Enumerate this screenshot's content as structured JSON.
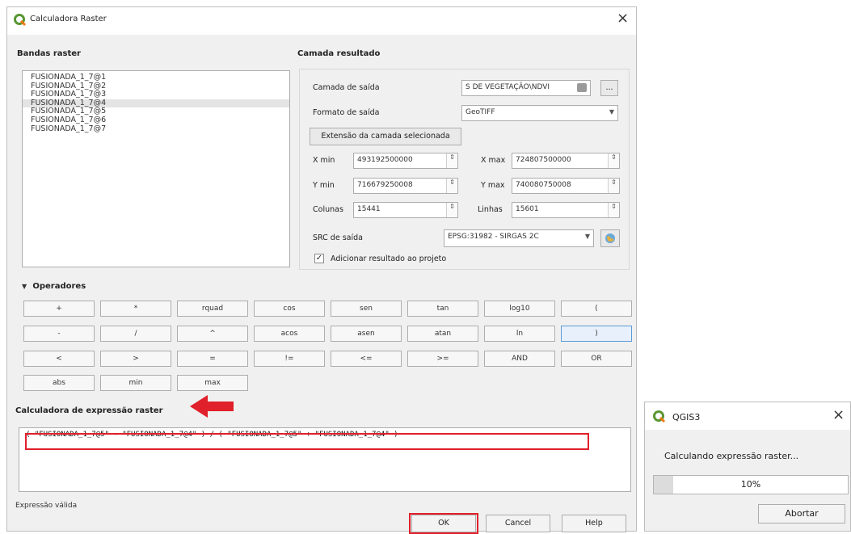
{
  "dialog": {
    "title": "Calculadora Raster",
    "close_glyph": "×"
  },
  "bands": {
    "title": "Bandas raster",
    "items": [
      "FUSIONADA_1_7@1",
      "FUSIONADA_1_7@2",
      "FUSIONADA_1_7@3",
      "FUSIONADA_1_7@4",
      "FUSIONADA_1_7@5",
      "FUSIONADA_1_7@6",
      "FUSIONADA_1_7@7"
    ],
    "selected_index": 3
  },
  "result": {
    "title": "Camada resultado",
    "output_layer_label": "Camada de saída",
    "output_layer_value": "S DE VEGETAÇÃO\\NDVI",
    "browse_label": "...",
    "format_label": "Formato de saída",
    "format_value": "GeoTIFF",
    "extent_button": "Extensão da camada selecionada",
    "xmin_label": "X min",
    "xmin_value": "493192500000",
    "xmax_label": "X max",
    "xmax_value": "724807500000",
    "ymin_label": "Y min",
    "ymin_value": "716679250008",
    "ymax_label": "Y max",
    "ymax_value": "740080750008",
    "columns_label": "Colunas",
    "columns_value": "15441",
    "rows_label": "Linhas",
    "rows_value": "15601",
    "crs_label": "SRC de saída",
    "crs_value": "EPSG:31982 - SIRGAS 2C",
    "add_to_project_label": "Adicionar resultado ao projeto",
    "add_to_project_checked": true
  },
  "operators": {
    "title": "Operadores",
    "rows": [
      [
        "+",
        "*",
        "rquad",
        "cos",
        "sen",
        "tan",
        "log10",
        "("
      ],
      [
        "-",
        "/",
        "^",
        "acos",
        "asen",
        "atan",
        "ln",
        ")"
      ],
      [
        "<",
        ">",
        "=",
        "!=",
        "<=",
        ">=",
        "AND",
        "OR"
      ],
      [
        "abs",
        "min",
        "max"
      ]
    ]
  },
  "expression": {
    "title": "Calculadora de expressão raster",
    "text": "( \"FUSIONADA_1_7@5\" - \"FUSIONADA_1_7@4\" )  /  ( \"FUSIONADA_1_7@5\" + \"FUSIONADA_1_7@4\" )",
    "status": "Expressão válida"
  },
  "buttons": {
    "ok": "OK",
    "cancel": "Cancel",
    "help": "Help"
  },
  "progress_dialog": {
    "title": "QGIS3",
    "message": "Calculando expressão raster...",
    "percent_text": "10%",
    "progress_fraction": 0.1,
    "abort": "Abortar"
  },
  "colors": {
    "highlight_red": "#e0202a",
    "qgis_green": "#589632"
  }
}
